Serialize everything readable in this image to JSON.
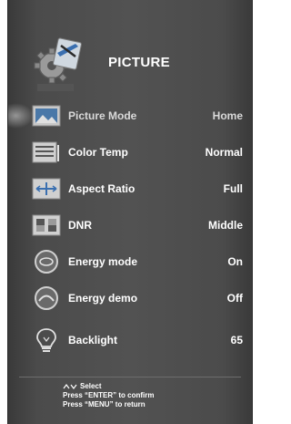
{
  "header": {
    "title": "PICTURE",
    "icon": "settings-gear-wrench-icon"
  },
  "menu": {
    "items": [
      {
        "label": "Picture Mode",
        "value": "Home",
        "icon": "picture-mode-icon",
        "selected": true
      },
      {
        "label": "Color Temp",
        "value": "Normal",
        "icon": "color-temp-icon",
        "selected": false
      },
      {
        "label": "Aspect Ratio",
        "value": "Full",
        "icon": "aspect-ratio-icon",
        "selected": false
      },
      {
        "label": "DNR",
        "value": "Middle",
        "icon": "dnr-icon",
        "selected": false
      },
      {
        "label": "Energy mode",
        "value": "On",
        "icon": "energy-mode-icon",
        "selected": false
      },
      {
        "label": "Energy demo",
        "value": "Off",
        "icon": "energy-demo-icon",
        "selected": false
      },
      {
        "label": "Backlight",
        "value": "65",
        "icon": "lightbulb-icon",
        "selected": false
      }
    ]
  },
  "footer": {
    "select": "Select",
    "enter_hint": "Press “ENTER” to confirm",
    "menu_hint": "Press “MENU” to return"
  },
  "colors": {
    "panel": "#4b4b4b",
    "text": "#ffffff",
    "accent": "#1a8fc9"
  }
}
